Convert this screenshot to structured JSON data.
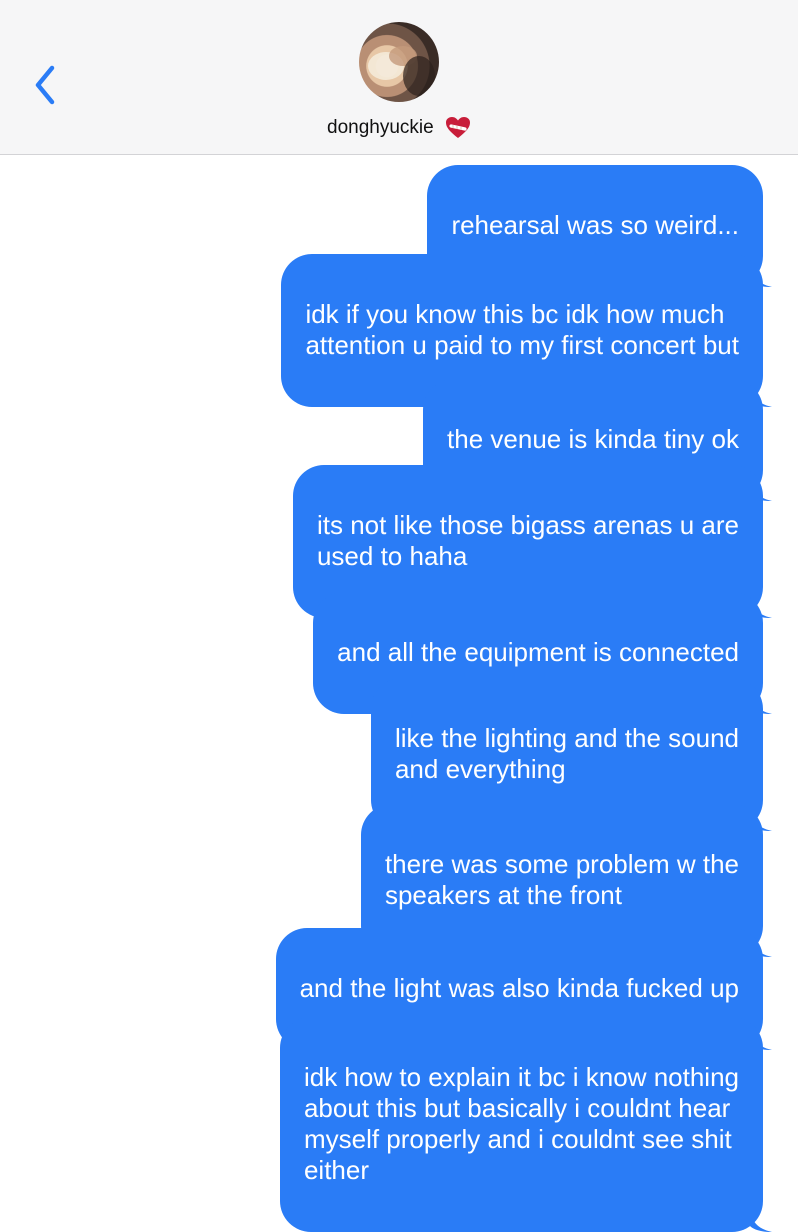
{
  "header": {
    "contact_name": "donghyuckie",
    "back_icon": "chevron-left-icon",
    "avatar_icon": "contact-photo",
    "heart_icon": "mending-heart-emoji",
    "accent_color": "#2a7cf6"
  },
  "messages": [
    {
      "text": "rehearsal was so weird..."
    },
    {
      "text": "idk if you know this bc idk how much\nattention u paid to my first concert but"
    },
    {
      "text": "the venue is kinda tiny ok"
    },
    {
      "text": "its not like those bigass arenas u are\nused to haha"
    },
    {
      "text": "and all the equipment is connected"
    },
    {
      "text": "like the lighting and the sound\nand everything"
    },
    {
      "text": "there was some problem w the\nspeakers at the front"
    },
    {
      "text": "and the light was also kinda fucked up"
    },
    {
      "text": "idk how to explain it bc i know nothing\nabout this but basically i couldnt hear\nmyself properly and i couldnt see shit\neither"
    }
  ]
}
